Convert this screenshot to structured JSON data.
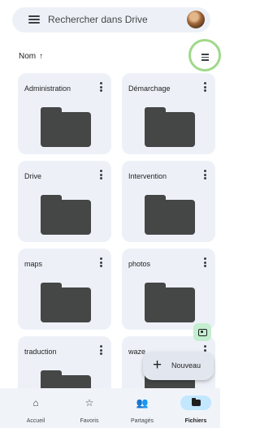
{
  "search": {
    "placeholder": "Rechercher dans Drive"
  },
  "sort": {
    "label": "Nom",
    "direction_symbol": "↑"
  },
  "folders": [
    {
      "name": "Administration"
    },
    {
      "name": "Démarchage"
    },
    {
      "name": "Drive"
    },
    {
      "name": "Intervention"
    },
    {
      "name": "maps"
    },
    {
      "name": "photos"
    },
    {
      "name": "traduction"
    },
    {
      "name": "waze"
    }
  ],
  "fab": {
    "new_label": "Nouveau",
    "plus": "+"
  },
  "bottom_nav": [
    {
      "label": "Accueil",
      "icon": "home-icon",
      "glyph": "⌂"
    },
    {
      "label": "Favoris",
      "icon": "star-icon",
      "glyph": "☆"
    },
    {
      "label": "Partagés",
      "icon": "people-icon",
      "glyph": "👥"
    },
    {
      "label": "Fichiers",
      "icon": "folder-icon",
      "glyph": "",
      "active": true
    }
  ],
  "colors": {
    "surface": "#edf1f7",
    "folder": "#444746",
    "active_pill": "#c2e7ff",
    "scan_bg": "#c4eed0",
    "highlight_ring": "#9fd98b"
  }
}
